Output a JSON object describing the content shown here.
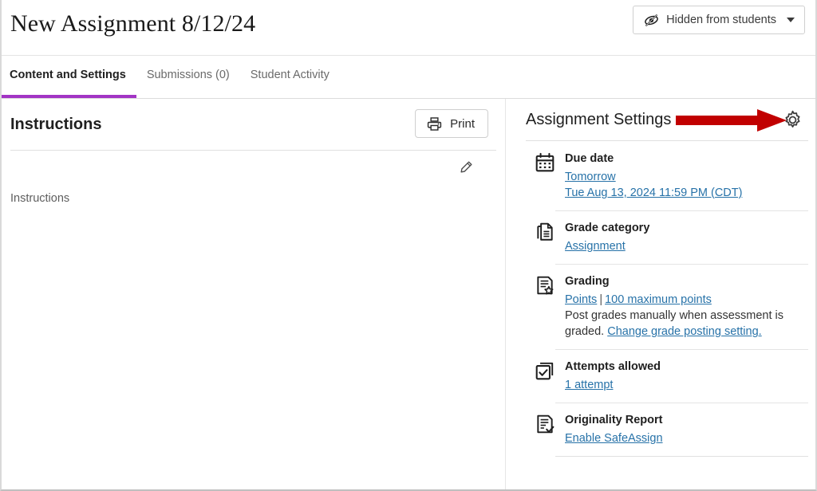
{
  "theme": {
    "accent": "#a234c4",
    "link": "#2772a8",
    "arrow": "#c10000",
    "text": "#1f1f1f"
  },
  "header": {
    "title": "New Assignment 8/12/24",
    "visibility": {
      "label": "Hidden from students",
      "icon": "eye-slash-icon",
      "caret": "chevron-down-icon"
    }
  },
  "tabs": [
    {
      "label": "Content and Settings",
      "active": true
    },
    {
      "label": "Submissions (0)",
      "active": false
    },
    {
      "label": "Student Activity",
      "active": false
    }
  ],
  "instructions": {
    "title": "Instructions",
    "print_label": "Print",
    "print_icon": "printer-icon",
    "edit_icon": "pencil-icon",
    "body_text": "Instructions"
  },
  "settings": {
    "title": "Assignment Settings",
    "gear_icon": "gear-icon",
    "annotation": "red-arrow-annotation",
    "items": [
      {
        "icon": "calendar-icon",
        "label": "Due date",
        "links": [
          "Tomorrow",
          "Tue Aug 13, 2024 11:59 PM (CDT)"
        ],
        "text": ""
      },
      {
        "icon": "document-icon",
        "label": "Grade category",
        "links": [
          "Assignment"
        ],
        "text": ""
      },
      {
        "icon": "grading-star-icon",
        "label": "Grading",
        "links": [
          "Points",
          "100 maximum points"
        ],
        "separator": "|",
        "text": "Post grades manually when assessment is graded.",
        "text_link": "Change grade posting setting."
      },
      {
        "icon": "checkbox-stack-icon",
        "label": "Attempts allowed",
        "links": [
          "1 attempt"
        ],
        "text": ""
      },
      {
        "icon": "report-check-icon",
        "label": "Originality Report",
        "links": [
          "Enable SafeAssign"
        ],
        "text": ""
      }
    ]
  }
}
